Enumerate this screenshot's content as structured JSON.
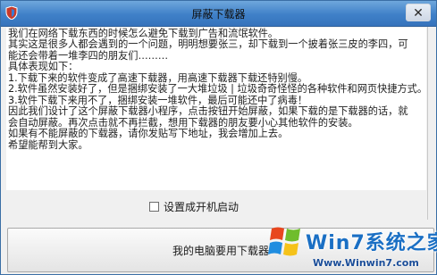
{
  "window": {
    "title": "屏蔽下载器",
    "close_glyph": "✕"
  },
  "content": {
    "lines": [
      "我们在网络下载东西的时候怎么避免下载到广告和流氓软件。",
      "其实这是很多人都会遇到的一个问题，明明想要张三，却下载到一个披着张三皮的李四，可",
      "能还会带着一堆李四的朋友们………",
      "具体表现如下：",
      "1.下载下来的软件变成了高速下载器，用高速下载器下载还特别慢。",
      "2.软件虽然安装好了，但是捆绑安装了一大堆垃圾 | 垃圾奇奇怪怪的各种软件和网页快捷方式。",
      "3.软件下载下来用不了，捆绑安装一堆软件，最后可能还中了病毒！",
      "因此我们设计了这个屏蔽下载器小程序，点击按钮开始屏蔽，如果下载的是下载器的话，就",
      "会自动屏蔽。再次点击就不再拦截，想用下载器的朋友要小心其他软件的安装。",
      "如果有不能屏蔽的下载器，请你发贴写下地址，我会增加上去。",
      "希望能帮到大家。"
    ]
  },
  "options": {
    "autostart_label": "设置成开机启动",
    "autostart_checked": false
  },
  "main_button": {
    "label": "我的电脑要用下载器"
  },
  "watermark": {
    "brand": "Win7系统之家",
    "url": "Www.Winwin7.com"
  },
  "colors": {
    "titlebar": "#3f80c8",
    "accent": "#1a6fc4"
  }
}
